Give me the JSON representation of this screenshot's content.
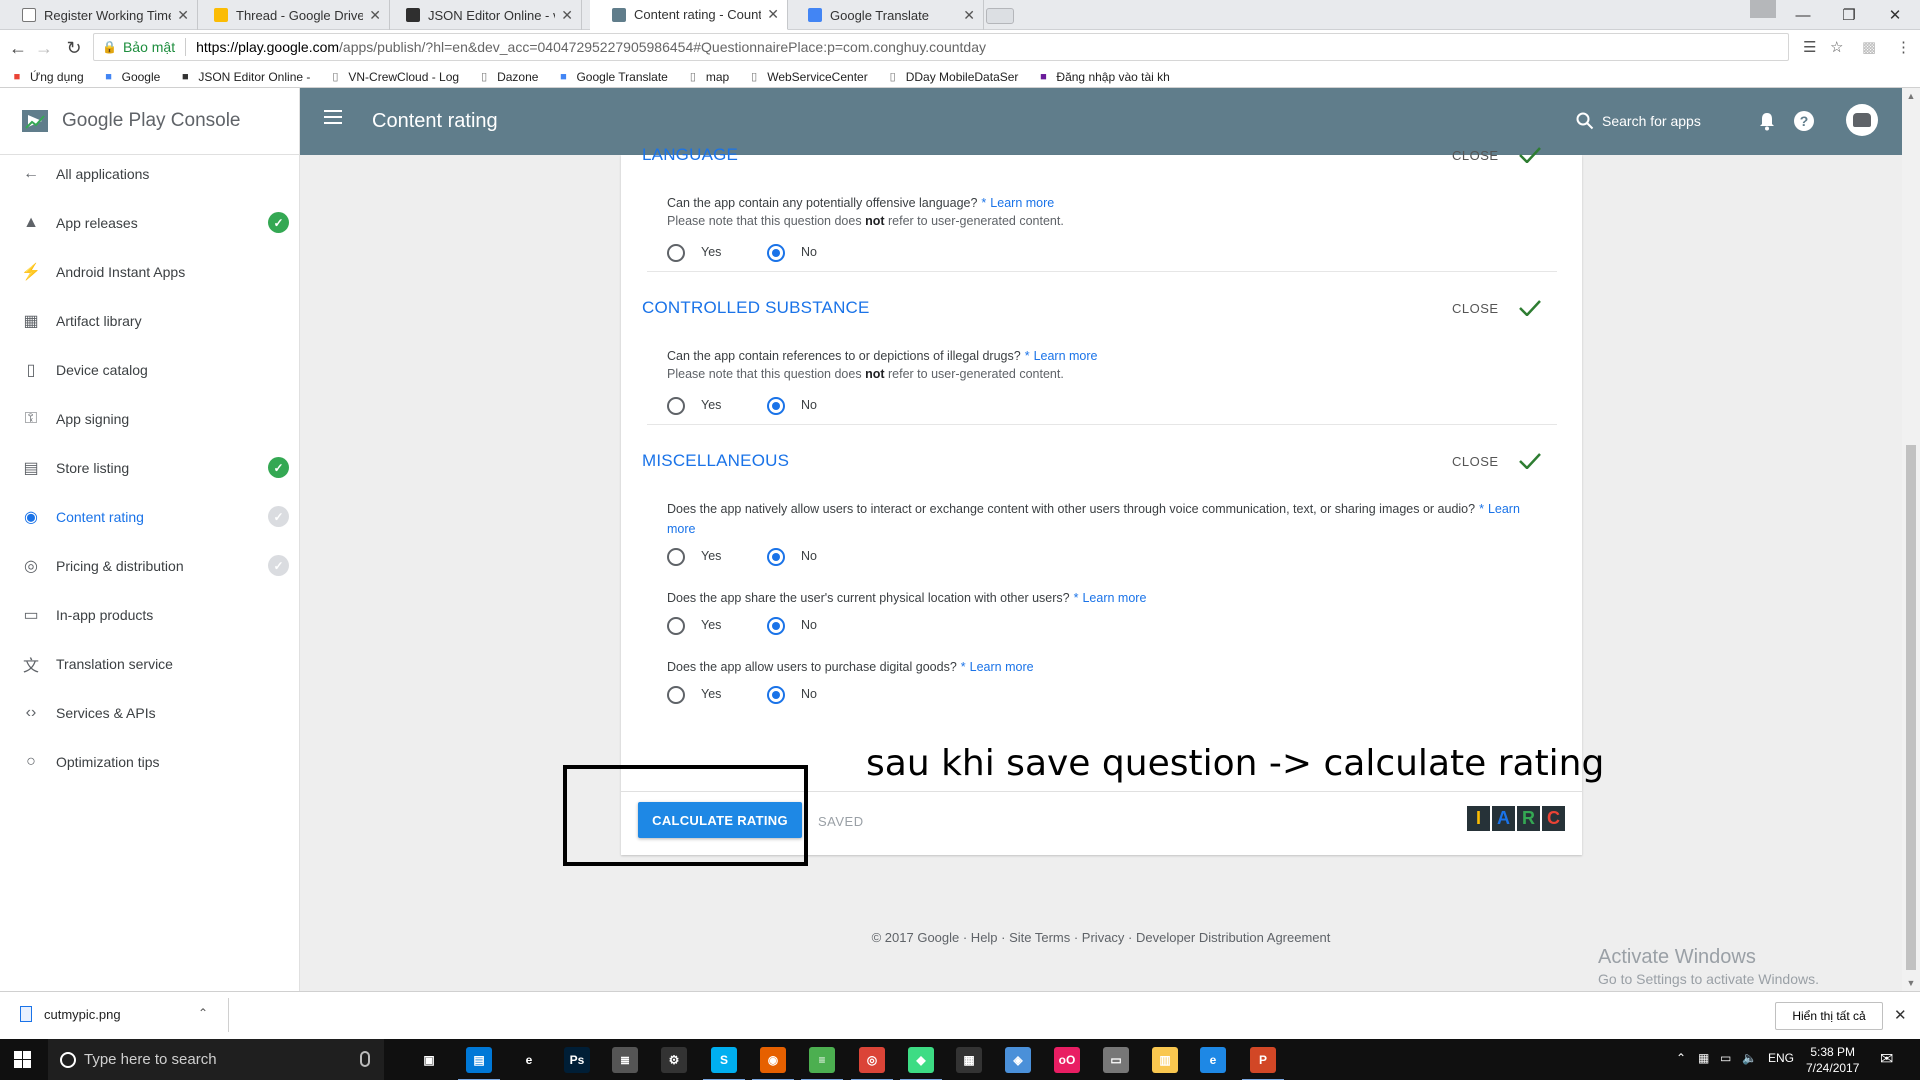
{
  "browser": {
    "tabs": [
      {
        "title": "Register Working Time",
        "active": false,
        "icon": "doc-icon",
        "color": "#ffffff"
      },
      {
        "title": "Thread - Google Drive",
        "active": false,
        "icon": "drive-icon",
        "color": "#fbbc04"
      },
      {
        "title": "JSON Editor Online - vie",
        "active": false,
        "icon": "json-icon",
        "color": "#2f2f2f"
      },
      {
        "title": "Content rating - Count D",
        "active": true,
        "icon": "play-console-icon",
        "color": "#607d8b"
      },
      {
        "title": "Google Translate",
        "active": false,
        "icon": "translate-icon",
        "color": "#4285f4"
      }
    ],
    "secure_label": "Bảo mật",
    "url_host": "https://play.google.com",
    "url_path": "/apps/publish/?hl=en&dev_acc=04047295227905986454#QuestionnairePlace:p=com.conghuy.countday",
    "bookmarks": [
      {
        "label": "Ứng dụng",
        "icon": "apps-grid-icon"
      },
      {
        "label": "Google",
        "icon": "google-icon"
      },
      {
        "label": "JSON Editor Online -",
        "icon": "json-icon"
      },
      {
        "label": "VN-CrewCloud - Log",
        "icon": "page-icon"
      },
      {
        "label": "Dazone",
        "icon": "page-icon"
      },
      {
        "label": "Google Translate",
        "icon": "translate-icon"
      },
      {
        "label": "map",
        "icon": "page-icon"
      },
      {
        "label": "WebServiceCenter",
        "icon": "page-icon"
      },
      {
        "label": "DDay MobileDataSer",
        "icon": "page-icon"
      },
      {
        "label": "Đăng nhập vào tài kh",
        "icon": "login-icon"
      }
    ]
  },
  "console": {
    "brand": "Google Play Console",
    "page_title": "Content rating",
    "search_label": "Search for apps",
    "nav": [
      {
        "label": "All applications",
        "icon": "arrow-back-icon",
        "status": "none",
        "active": false
      },
      {
        "label": "App releases",
        "icon": "rocket-icon",
        "status": "done",
        "active": false
      },
      {
        "label": "Android Instant Apps",
        "icon": "bolt-icon",
        "status": "none",
        "active": false
      },
      {
        "label": "Artifact library",
        "icon": "library-icon",
        "status": "none",
        "active": false
      },
      {
        "label": "Device catalog",
        "icon": "device-icon",
        "status": "none",
        "active": false
      },
      {
        "label": "App signing",
        "icon": "key-icon",
        "status": "none",
        "active": false
      },
      {
        "label": "Store listing",
        "icon": "store-icon",
        "status": "done",
        "active": false
      },
      {
        "label": "Content rating",
        "icon": "rating-icon",
        "status": "pending",
        "active": true
      },
      {
        "label": "Pricing & distribution",
        "icon": "globe-icon",
        "status": "pending",
        "active": false
      },
      {
        "label": "In-app products",
        "icon": "card-icon",
        "status": "none",
        "active": false
      },
      {
        "label": "Translation service",
        "icon": "translate-icon",
        "status": "none",
        "active": false
      },
      {
        "label": "Services & APIs",
        "icon": "code-icon",
        "status": "none",
        "active": false
      },
      {
        "label": "Optimization tips",
        "icon": "bulb-icon",
        "status": "none",
        "active": false
      }
    ]
  },
  "questionnaire": {
    "close_label": "CLOSE",
    "yes_label": "Yes",
    "no_label": "No",
    "learn_more": "Learn more",
    "required_mark": "*",
    "note_prefix": "Please note that this question does",
    "note_bold": "not",
    "note_suffix": "refer to user-generated content.",
    "sections": [
      {
        "title": "LANGUAGE",
        "questions": [
          {
            "text": "Can the app contain any potentially offensive language?",
            "note": true,
            "answer": "No"
          }
        ]
      },
      {
        "title": "CONTROLLED SUBSTANCE",
        "questions": [
          {
            "text": "Can the app contain references to or depictions of illegal drugs?",
            "note": true,
            "answer": "No"
          }
        ]
      },
      {
        "title": "MISCELLANEOUS",
        "questions": [
          {
            "text": "Does the app natively allow users to interact or exchange content with other users through voice communication, text, or sharing images or audio?",
            "note": false,
            "answer": "No"
          },
          {
            "text": "Does the app share the user's current physical location with other users?",
            "note": false,
            "answer": "No"
          },
          {
            "text": "Does the app allow users to purchase digital goods?",
            "note": false,
            "answer": "No"
          }
        ]
      }
    ],
    "calculate_label": "CALCULATE RATING",
    "saved_label": "SAVED",
    "iarc_letters": [
      "I",
      "A",
      "R",
      "C"
    ],
    "iarc_colors": [
      "#fbbc04",
      "#1a73e8",
      "#34a853",
      "#ea4335"
    ]
  },
  "annotation": "sau khi save question -> calculate rating",
  "footer": "© 2017 Google · Help · Site Terms · Privacy · Developer Distribution Agreement",
  "watermark": {
    "line1": "Activate Windows",
    "line2": "Go to Settings to activate Windows."
  },
  "downloads": {
    "file": "cutmypic.png",
    "show_all": "Hiển thị tất cả"
  },
  "taskbar": {
    "search_placeholder": "Type here to search",
    "lang": "ENG",
    "time": "5:38 PM",
    "date": "7/24/2017"
  }
}
